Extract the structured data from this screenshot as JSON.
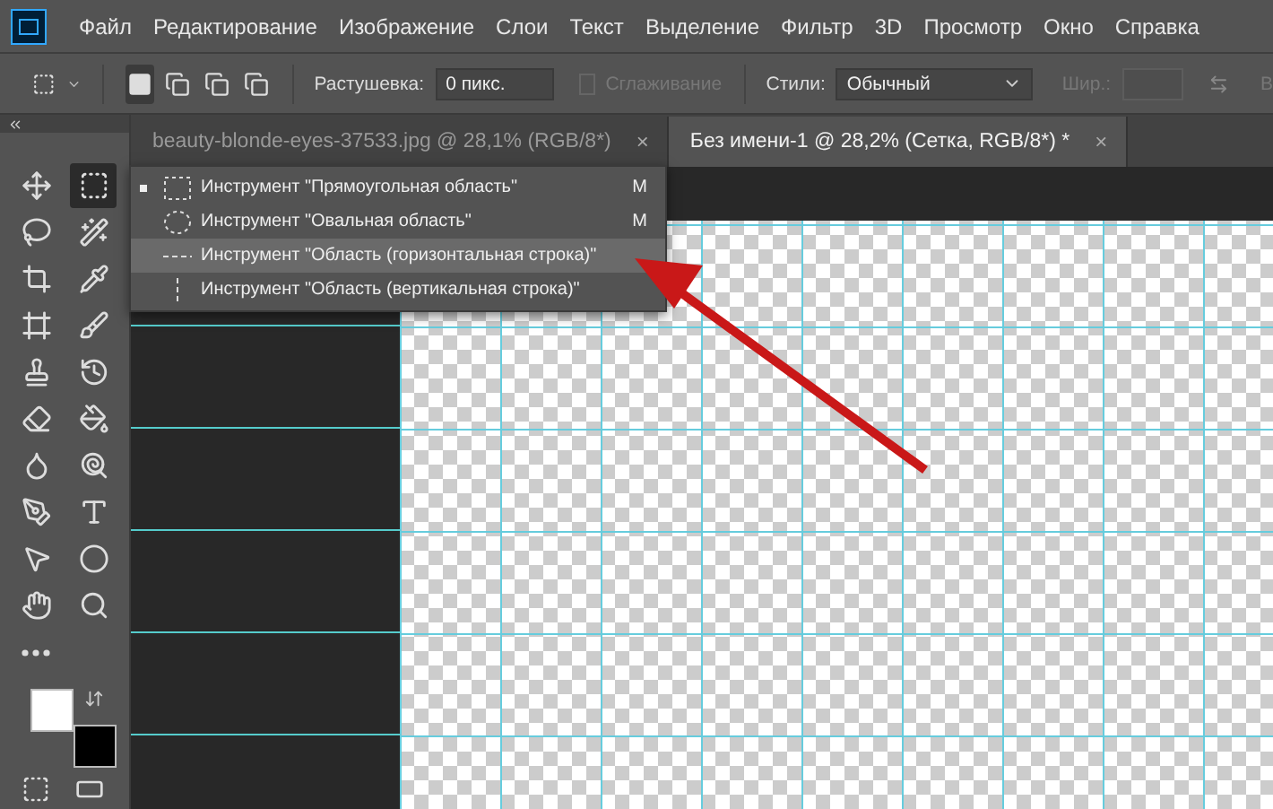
{
  "menu": [
    "Файл",
    "Редактирование",
    "Изображение",
    "Слои",
    "Текст",
    "Выделение",
    "Фильтр",
    "3D",
    "Просмотр",
    "Окно",
    "Справка"
  ],
  "options_bar": {
    "modes": [
      {
        "kind": "new",
        "selected": true
      },
      {
        "kind": "add",
        "selected": false
      },
      {
        "kind": "subtract",
        "selected": false
      },
      {
        "kind": "intersect",
        "selected": false
      }
    ],
    "feather_label": "Растушевка:",
    "feather_value": "0 пикс.",
    "antialias": {
      "label": "Сглаживание",
      "checked": false,
      "disabled": true
    },
    "style_label": "Стили:",
    "style_value": "Обычный",
    "width_label": "Шир.:",
    "cut_label": "В"
  },
  "tabs": [
    {
      "label": "beauty-blonde-eyes-37533.jpg @ 28,1% (RGB/8*)",
      "selected": false,
      "close": "×"
    },
    {
      "label": "Без имени-1 @ 28,2% (Сетка, RGB/8*) *",
      "selected": true,
      "close": "×"
    }
  ],
  "tools": [
    {
      "kind": "move",
      "selected": false
    },
    {
      "kind": "marquee",
      "selected": true
    },
    {
      "kind": "lasso",
      "selected": false
    },
    {
      "kind": "wand",
      "selected": false
    },
    {
      "kind": "crop",
      "selected": false
    },
    {
      "kind": "eyedropper",
      "selected": false
    },
    {
      "kind": "frame",
      "selected": false
    },
    {
      "kind": "brush",
      "selected": false
    },
    {
      "kind": "stamp",
      "selected": false
    },
    {
      "kind": "history",
      "selected": false
    },
    {
      "kind": "eraser",
      "selected": false
    },
    {
      "kind": "bucket",
      "selected": false
    },
    {
      "kind": "smudge",
      "selected": false
    },
    {
      "kind": "dodge",
      "selected": false
    },
    {
      "kind": "pen",
      "selected": false
    },
    {
      "kind": "type",
      "selected": false
    },
    {
      "kind": "pointer",
      "selected": false
    },
    {
      "kind": "ellipse",
      "selected": false
    },
    {
      "kind": "hand",
      "selected": false
    },
    {
      "kind": "zoom",
      "selected": false
    },
    {
      "kind": "more",
      "selected": false
    }
  ],
  "flyout": [
    {
      "kind": "rect",
      "label": "Инструмент \"Прямоугольная область\"",
      "shortcut": "M",
      "selected": true,
      "hovered": false
    },
    {
      "kind": "ellipse",
      "label": "Инструмент \"Овальная область\"",
      "shortcut": "M",
      "selected": false,
      "hovered": false
    },
    {
      "kind": "row",
      "label": "Инструмент \"Область (горизонтальная строка)\"",
      "selected": false,
      "hovered": true
    },
    {
      "kind": "column",
      "label": "Инструмент \"Область (вертикальная строка)\"",
      "selected": false,
      "hovered": false
    }
  ]
}
